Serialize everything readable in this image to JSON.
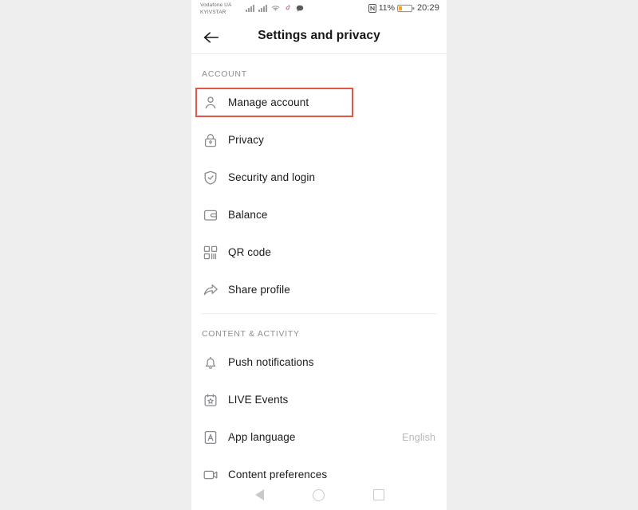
{
  "statusbar": {
    "carrier_line1": "Vodafone UA",
    "carrier_line2": "KYIVSTAR",
    "nfc_icon": "nfc-icon",
    "battery_percent": "11%",
    "clock": "20:29",
    "icons": [
      "signal-bars-icon",
      "signal-bars-icon",
      "wifi-icon",
      "tiktok-icon",
      "chat-bubble-icon"
    ]
  },
  "header": {
    "back_icon": "back-arrow-icon",
    "title": "Settings and privacy"
  },
  "sections": [
    {
      "title": "ACCOUNT",
      "items": [
        {
          "label": "Manage account",
          "icon": "person-icon",
          "value": "",
          "highlighted": true
        },
        {
          "label": "Privacy",
          "icon": "lock-icon",
          "value": "",
          "highlighted": false
        },
        {
          "label": "Security and login",
          "icon": "shield-check-icon",
          "value": "",
          "highlighted": false
        },
        {
          "label": "Balance",
          "icon": "wallet-icon",
          "value": "",
          "highlighted": false
        },
        {
          "label": "QR code",
          "icon": "qr-code-icon",
          "value": "",
          "highlighted": false
        },
        {
          "label": "Share profile",
          "icon": "share-arrow-icon",
          "value": "",
          "highlighted": false
        }
      ]
    },
    {
      "title": "CONTENT & ACTIVITY",
      "items": [
        {
          "label": "Push notifications",
          "icon": "bell-icon",
          "value": "",
          "highlighted": false
        },
        {
          "label": "LIVE Events",
          "icon": "calendar-star-icon",
          "value": "",
          "highlighted": false
        },
        {
          "label": "App language",
          "icon": "letter-a-box-icon",
          "value": "English",
          "highlighted": false
        },
        {
          "label": "Content preferences",
          "icon": "video-camera-icon",
          "value": "",
          "highlighted": false
        }
      ]
    }
  ],
  "navbar": {
    "back": "nav-back-icon",
    "home": "nav-home-icon",
    "recents": "nav-recents-icon"
  },
  "colors": {
    "highlight": "#e35646",
    "page_bg": "#eeeeee",
    "screen_bg": "#ffffff",
    "text": "#1b1b1f",
    "muted": "#8e8e93"
  }
}
